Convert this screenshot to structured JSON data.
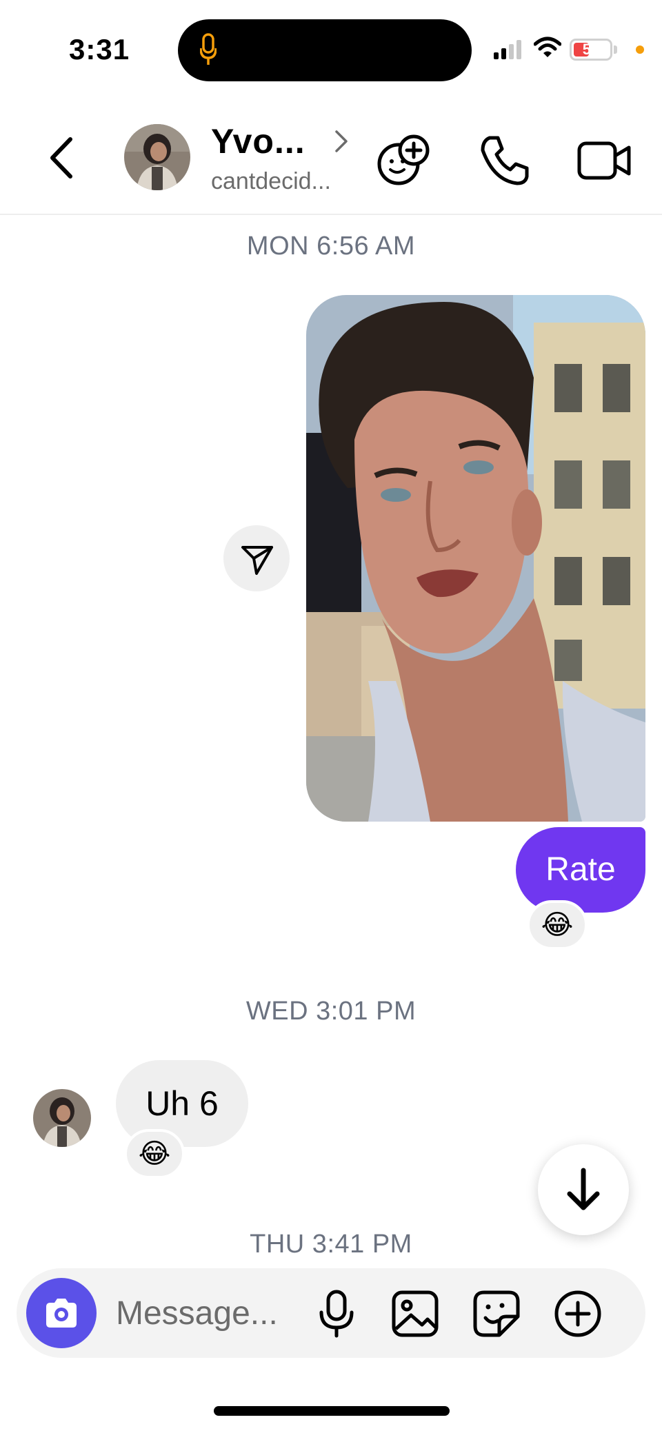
{
  "status_bar": {
    "time": "3:31",
    "battery": "54",
    "icons": [
      "microphone-icon",
      "signal-icon",
      "wifi-icon",
      "battery-icon"
    ]
  },
  "header": {
    "contact_name": "Yvo...",
    "username": "cantdecid...",
    "icons": [
      "back-icon",
      "chevron-right-icon",
      "add-people-icon",
      "phone-icon",
      "video-icon"
    ]
  },
  "thread": {
    "ts_1": "MON 6:56 AM",
    "ts_2": "WED 3:01 PM",
    "ts_3": "THU 3:41 PM",
    "outgoing_text": "Rate",
    "outgoing_reaction": "😂",
    "incoming_text": "Uh 6",
    "incoming_reaction": "😂"
  },
  "composer": {
    "placeholder": "Message...",
    "icons": [
      "camera-icon",
      "microphone-icon",
      "gallery-icon",
      "sticker-icon",
      "plus-icon"
    ]
  },
  "colors": {
    "accent_purple": "#7037f0",
    "camera_blue": "#5b51e8",
    "timestamp_gray": "#6b7280"
  }
}
